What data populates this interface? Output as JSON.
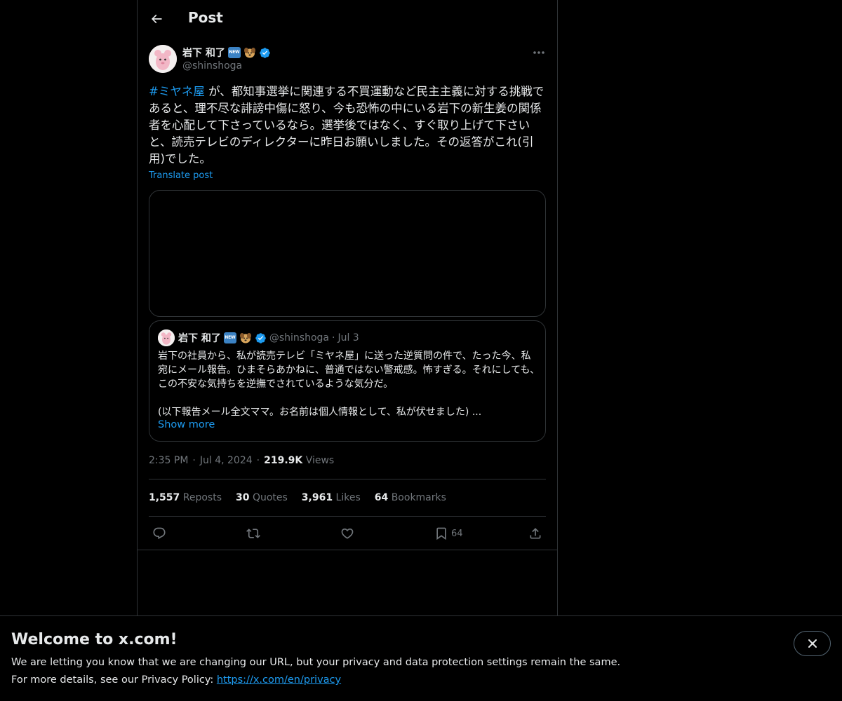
{
  "header": {
    "title": "Post"
  },
  "post": {
    "author_name": "岩下 和了",
    "new_badge": "NEW",
    "handle": "@shinshoga",
    "hashtag": "#ミヤネ屋",
    "text": " が、都知事選挙に関連する不買運動など民主主義に対する挑戦であると、理不尽な誹謗中傷に怒り、今も恐怖の中にいる岩下の新生姜の関係者を心配して下さっているなら。選挙後ではなく、すぐ取り上げて下さいと、読売テレビのディレクターに昨日お願いしました。その返答がこれ(引用)でした。",
    "translate": "Translate post",
    "time": "2:35 PM",
    "date": "Jul 4, 2024",
    "views_count": "219.9K",
    "views_label": "Views"
  },
  "quote": {
    "author_name": "岩下 和了",
    "new_badge": "NEW",
    "handle": "@shinshoga",
    "dot": "·",
    "date": "Jul 3",
    "line1": "岩下の社員から、私が読売テレビ「ミヤネ屋」に送った逆質問の件で、たった今、私宛にメール報告。ひまそらあかねに、普通ではない警戒感。怖すぎる。それにしても、この不安な気持ちを逆撫でされているような気分だ。",
    "line2": "(以下報告メール全文ママ。お名前は個人情報として、私が伏せました) ...",
    "show_more": "Show more"
  },
  "meta": {
    "dot": "·"
  },
  "stats": [
    {
      "count": "1,557",
      "label": "Reposts"
    },
    {
      "count": "30",
      "label": "Quotes"
    },
    {
      "count": "3,961",
      "label": "Likes"
    },
    {
      "count": "64",
      "label": "Bookmarks"
    }
  ],
  "actions": {
    "bookmark_count": "64"
  },
  "banner": {
    "title": "Welcome to x.com!",
    "line1": "We are letting you know that we are changing our URL, but your privacy and data protection settings remain the same.",
    "line2_prefix": "For more details, see our Privacy Policy: ",
    "link": "https://x.com/en/privacy"
  },
  "colors": {
    "background": "#000000",
    "accent": "#1d9bf0",
    "text": "#e7e9ea",
    "muted": "#71767b",
    "border": "#2f3336"
  }
}
